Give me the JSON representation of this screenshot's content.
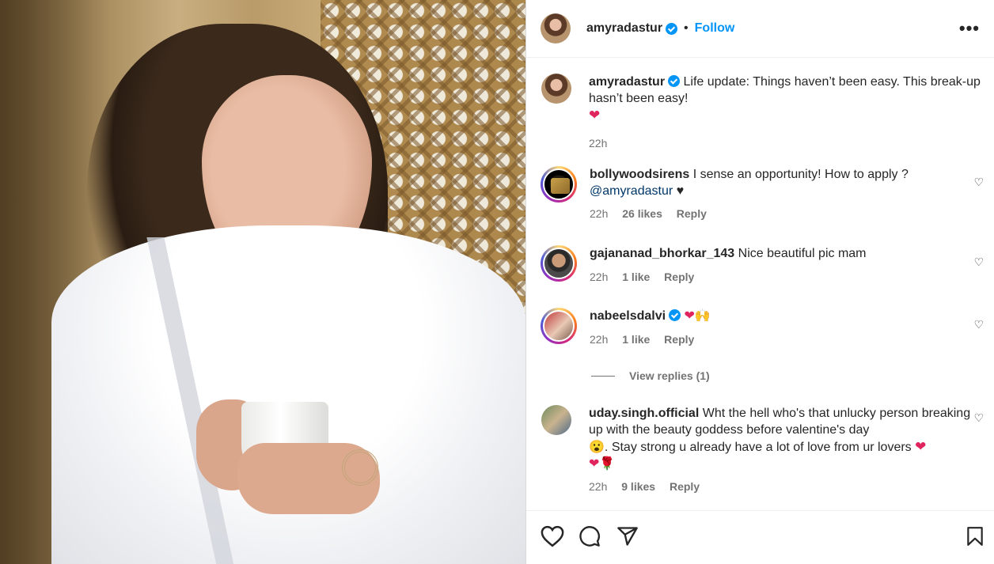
{
  "post_header": {
    "username": "amyradastur",
    "separator": "•",
    "follow_label": "Follow",
    "more_label": "•••"
  },
  "caption": {
    "username": "amyradastur",
    "text": "Life update: Things haven’t been easy. This break-up hasn’t been easy!",
    "emoji": "❤",
    "time": "22h"
  },
  "comments": [
    {
      "username": "bollywoodsirens",
      "text": "I sense an opportunity! How to apply ?",
      "mention": "@amyradastur",
      "emoji": "♥",
      "time": "22h",
      "likes": "26 likes",
      "reply_label": "Reply"
    },
    {
      "username": "gajananad_bhorkar_143",
      "text": "Nice beautiful pic mam",
      "time": "22h",
      "likes": "1 like",
      "reply_label": "Reply"
    },
    {
      "username": "nabeelsdalvi",
      "emoji": "❤🙌",
      "time": "22h",
      "likes": "1 like",
      "reply_label": "Reply",
      "view_replies": "View replies (1)"
    },
    {
      "username": "uday.singh.official",
      "text": "Wht the hell who's that unlucky person breaking up with the beauty goddess before valentine's day",
      "emoji_a": "😮",
      "text2": ". Stay strong u already have a lot of love from ur lovers",
      "emoji_b": "❤",
      "emoji_c": "❤🌹",
      "time": "22h",
      "likes": "9 likes",
      "reply_label": "Reply"
    }
  ],
  "action_icons": [
    "heart-icon",
    "comment-icon",
    "share-icon",
    "bookmark-icon"
  ],
  "colors": {
    "accent": "#0095f6",
    "text": "#262626",
    "muted": "#737373"
  }
}
